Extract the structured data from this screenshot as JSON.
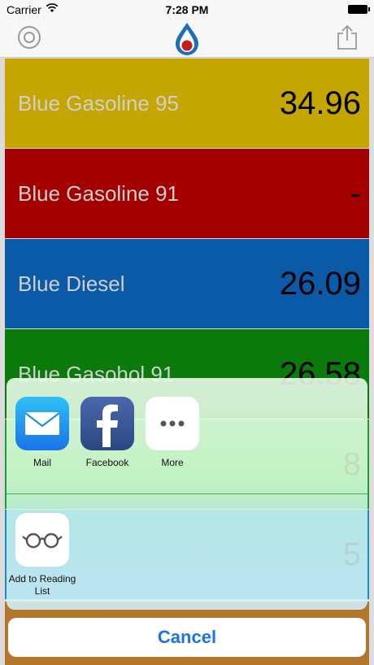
{
  "status_bar": {
    "carrier": "Carrier",
    "time": "7:28 PM"
  },
  "nav_bar": {
    "left_icon": "gear-icon",
    "center_icon": "fuel-drop-logo-icon",
    "right_icon": "share-icon"
  },
  "fuel_list": [
    {
      "name": "Blue Gasoline 95",
      "price": "34.96",
      "color": "#c5a600"
    },
    {
      "name": "Blue Gasoline 91",
      "price": "-",
      "color": "#a50000"
    },
    {
      "name": "Blue Diesel",
      "price": "26.09",
      "color": "#0b5aa8"
    },
    {
      "name": "Blue Gasohol 91",
      "price": "26.58",
      "color": "#0a7a0a"
    },
    {
      "name": "",
      "price": "8",
      "color": "#1aa02a"
    },
    {
      "name": "",
      "price": "5",
      "color": "#1b8cc4"
    }
  ],
  "share_sheet": {
    "apps": [
      {
        "label": "Mail",
        "icon": "mail-icon"
      },
      {
        "label": "Facebook",
        "icon": "facebook-icon"
      },
      {
        "label": "More",
        "icon": "more-dots-icon"
      }
    ],
    "actions": [
      {
        "label": "Add to Reading List",
        "icon": "reading-glasses-icon"
      }
    ],
    "cancel_label": "Cancel"
  },
  "colors": {
    "accent": "#1a73e8",
    "bottom_strip": "#b2772c"
  }
}
